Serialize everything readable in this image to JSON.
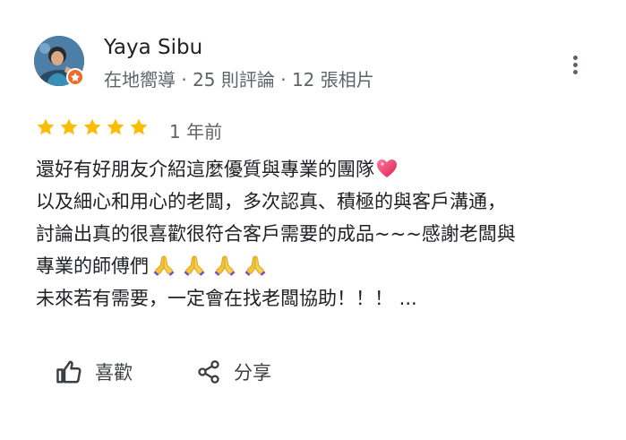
{
  "reviewer": {
    "name": "Yaya Sibu",
    "meta": "在地嚮導 · 25 則評論 · 12 張相片"
  },
  "review": {
    "rating": 5,
    "max_rating": 5,
    "time": "1 年前",
    "lines": [
      "還好有好朋友介紹這麼優質與專業的團隊",
      "以及細心和用心的老闆，多次認真、積極的與客戶溝通，",
      "討論出真的很喜歡很符合客戶需要的成品~~~感謝老闆與",
      "專業的師傅們",
      "未來若有需要，一定會在找老闆協助！！！ ..."
    ],
    "emoji": {
      "heart": "heart-icon",
      "praying_hands_count": 4
    }
  },
  "actions": {
    "like_label": "喜歡",
    "share_label": "分享"
  },
  "colors": {
    "star": "#fbbc04",
    "text": "#202124",
    "secondary": "#5f6368",
    "badge": "#f06a27",
    "heart": "#e8436b"
  }
}
